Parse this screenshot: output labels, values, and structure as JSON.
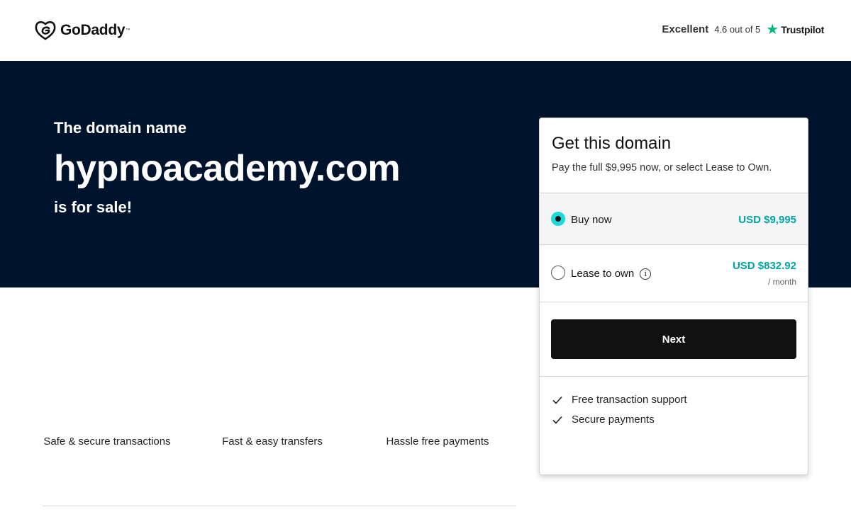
{
  "header": {
    "logo_text": "GoDaddy",
    "trust_rating": "Excellent",
    "trust_score": "4.6 out of 5",
    "trust_brand": "Trustpilot"
  },
  "hero": {
    "pre": "The domain name",
    "domain": "hypnoacademy.com",
    "post": "is for sale!"
  },
  "features": [
    "Safe & secure transactions",
    "Fast & easy transfers",
    "Hassle free payments"
  ],
  "card": {
    "title": "Get this domain",
    "subtitle": "Pay the full $9,995 now, or select Lease to Own.",
    "options": [
      {
        "label": "Buy now",
        "price": "USD $9,995",
        "selected": true
      },
      {
        "label": "Lease to own",
        "price": "USD $832.92",
        "period": "/ month",
        "selected": false
      }
    ],
    "next_label": "Next",
    "benefits": [
      "Free transaction support",
      "Secure payments"
    ]
  },
  "colors": {
    "hero_bg": "#00132d",
    "accent_teal": "#00a4a6",
    "radio_selected": "#1bdbdb",
    "trustpilot_green": "#00b67a",
    "button_bg": "#111111"
  },
  "icons": [
    "godaddy-logo-icon",
    "trustpilot-star-icon",
    "radio-selected-icon",
    "radio-unselected-icon",
    "info-icon",
    "check-icon"
  ]
}
